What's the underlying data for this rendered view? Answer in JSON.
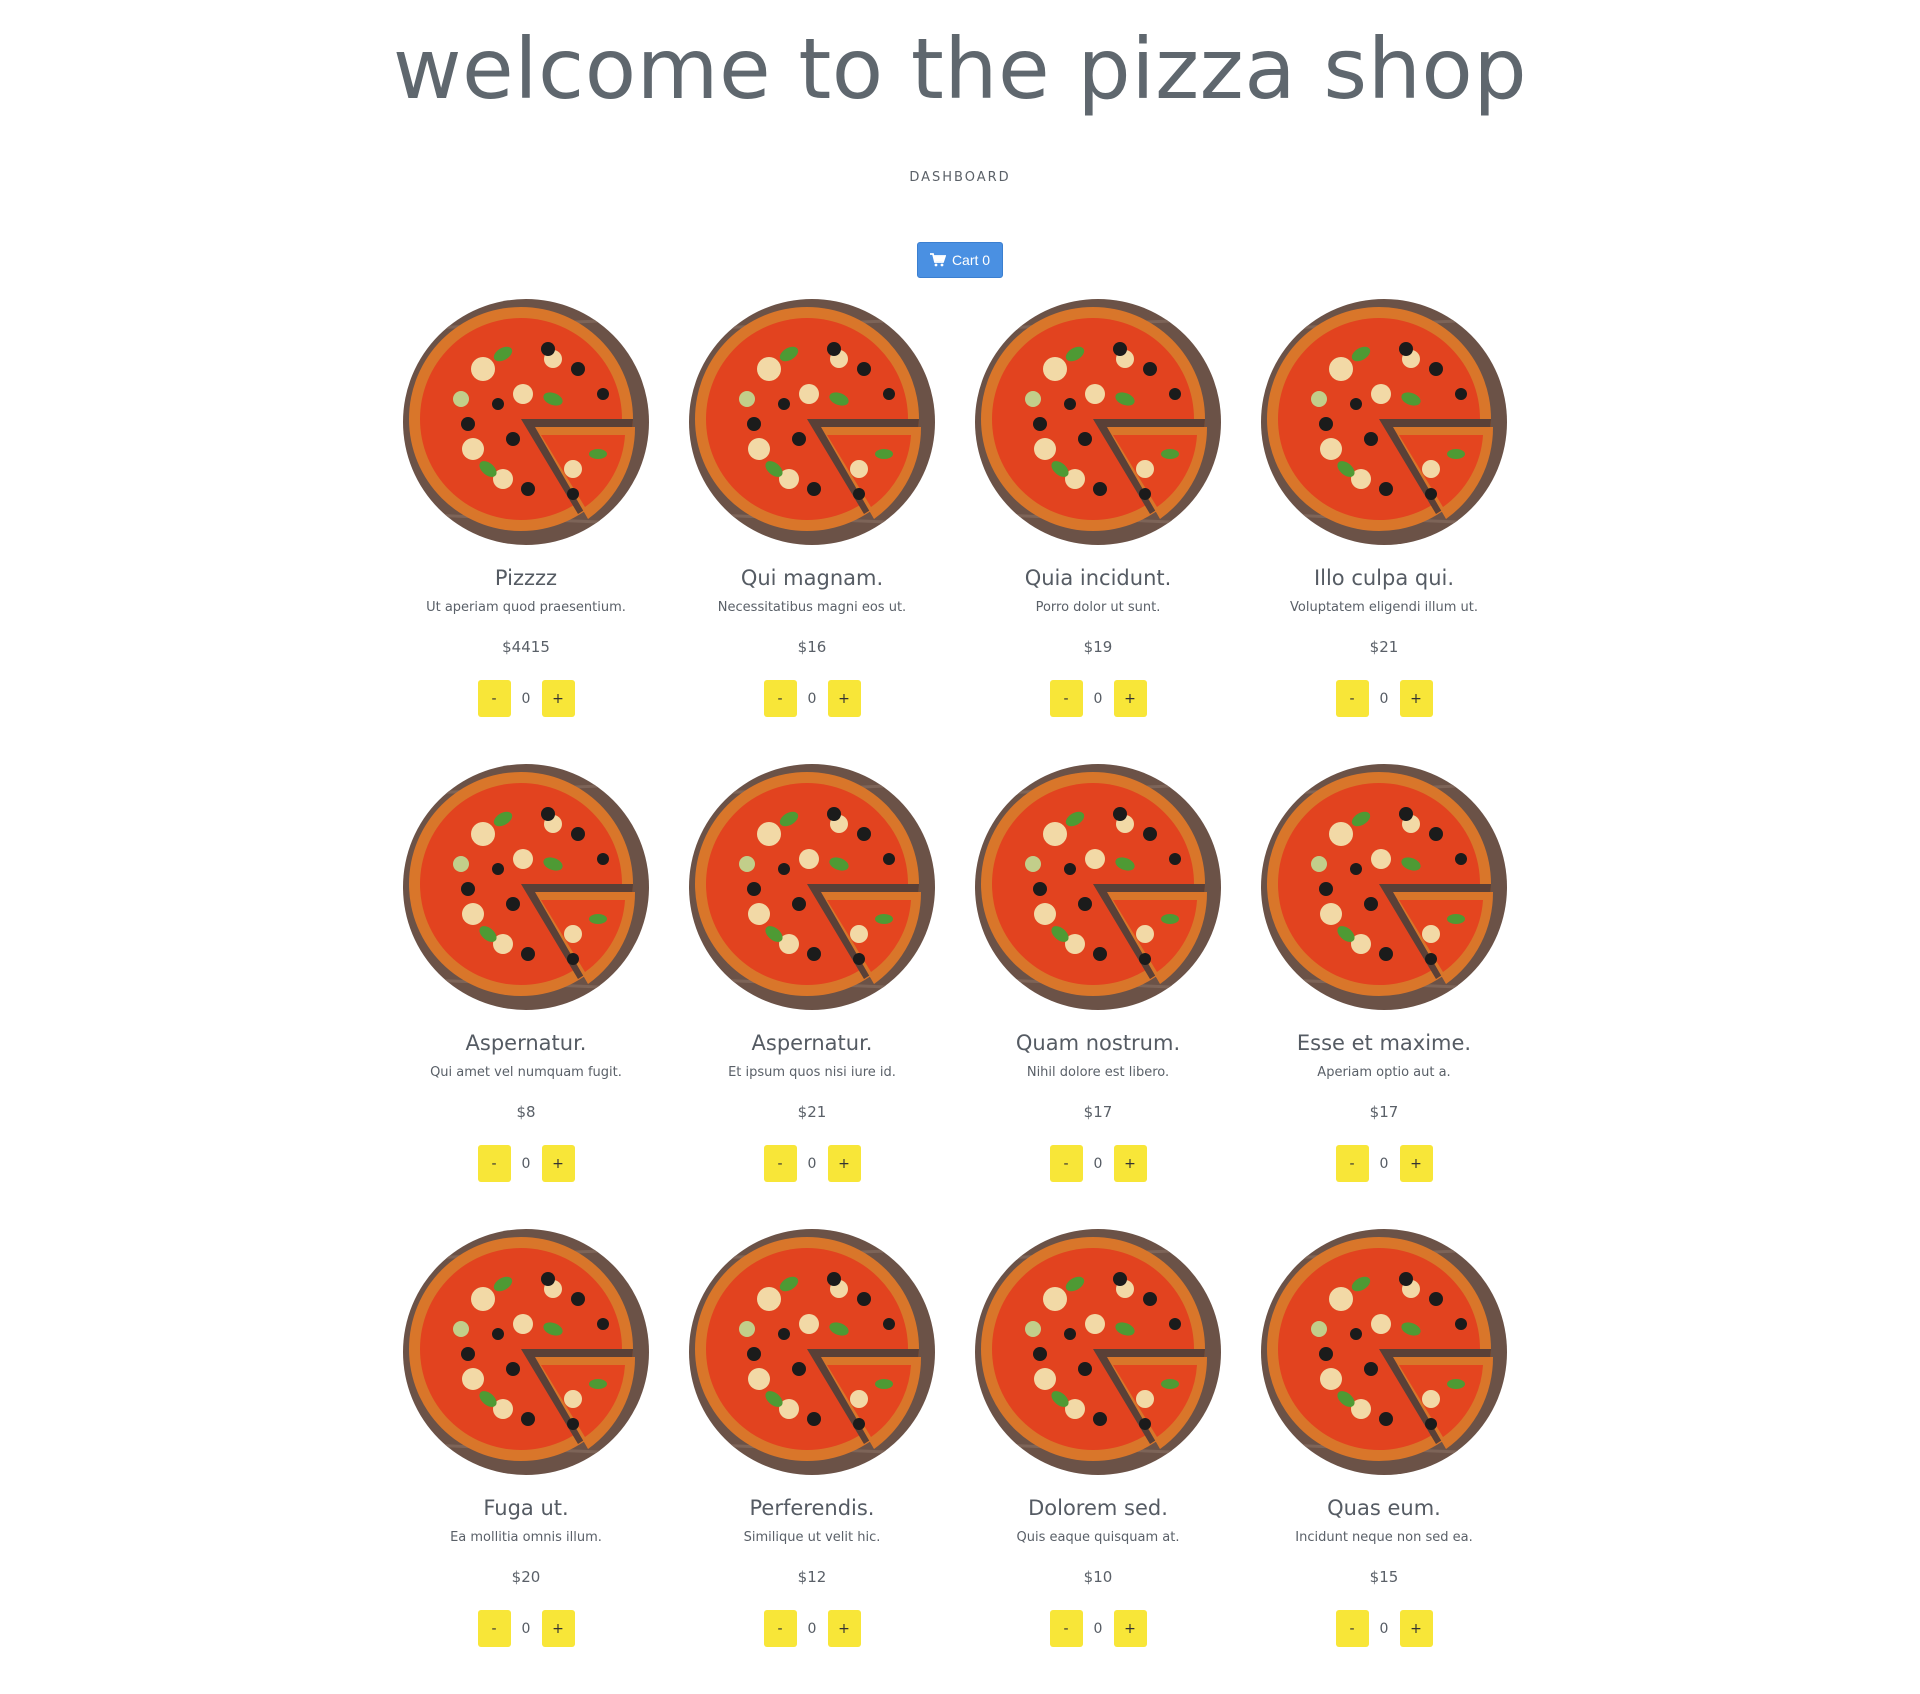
{
  "header": {
    "title": "welcome to the pizza shop",
    "nav_link": "DASHBOARD"
  },
  "cart": {
    "label": "Cart 0",
    "icon": "shopping-cart-icon",
    "color": "#4a90e2"
  },
  "colors": {
    "accent": "#4a90e2",
    "qty_button": "#f8e638"
  },
  "products": [
    {
      "name": "Pizzzz",
      "description": "Ut aperiam quod praesentium.",
      "price": "$4415",
      "quantity": "0",
      "minus": "-",
      "plus": "+"
    },
    {
      "name": "Qui magnam.",
      "description": "Necessitatibus magni eos ut.",
      "price": "$16",
      "quantity": "0",
      "minus": "-",
      "plus": "+"
    },
    {
      "name": "Quia incidunt.",
      "description": "Porro dolor ut sunt.",
      "price": "$19",
      "quantity": "0",
      "minus": "-",
      "plus": "+"
    },
    {
      "name": "Illo culpa qui.",
      "description": "Voluptatem eligendi illum ut.",
      "price": "$21",
      "quantity": "0",
      "minus": "-",
      "plus": "+"
    },
    {
      "name": "Aspernatur.",
      "description": "Qui amet vel numquam fugit.",
      "price": "$8",
      "quantity": "0",
      "minus": "-",
      "plus": "+"
    },
    {
      "name": "Aspernatur.",
      "description": "Et ipsum quos nisi iure id.",
      "price": "$21",
      "quantity": "0",
      "minus": "-",
      "plus": "+"
    },
    {
      "name": "Quam nostrum.",
      "description": "Nihil dolore est libero.",
      "price": "$17",
      "quantity": "0",
      "minus": "-",
      "plus": "+"
    },
    {
      "name": "Esse et maxime.",
      "description": "Aperiam optio aut a.",
      "price": "$17",
      "quantity": "0",
      "minus": "-",
      "plus": "+"
    },
    {
      "name": "Fuga ut.",
      "description": "Ea mollitia omnis illum.",
      "price": "$20",
      "quantity": "0",
      "minus": "-",
      "plus": "+"
    },
    {
      "name": "Perferendis.",
      "description": "Similique ut velit hic.",
      "price": "$12",
      "quantity": "0",
      "minus": "-",
      "plus": "+"
    },
    {
      "name": "Dolorem sed.",
      "description": "Quis eaque quisquam at.",
      "price": "$10",
      "quantity": "0",
      "minus": "-",
      "plus": "+"
    },
    {
      "name": "Quas eum.",
      "description": "Incidunt neque non sed ea.",
      "price": "$15",
      "quantity": "0",
      "minus": "-",
      "plus": "+"
    }
  ]
}
